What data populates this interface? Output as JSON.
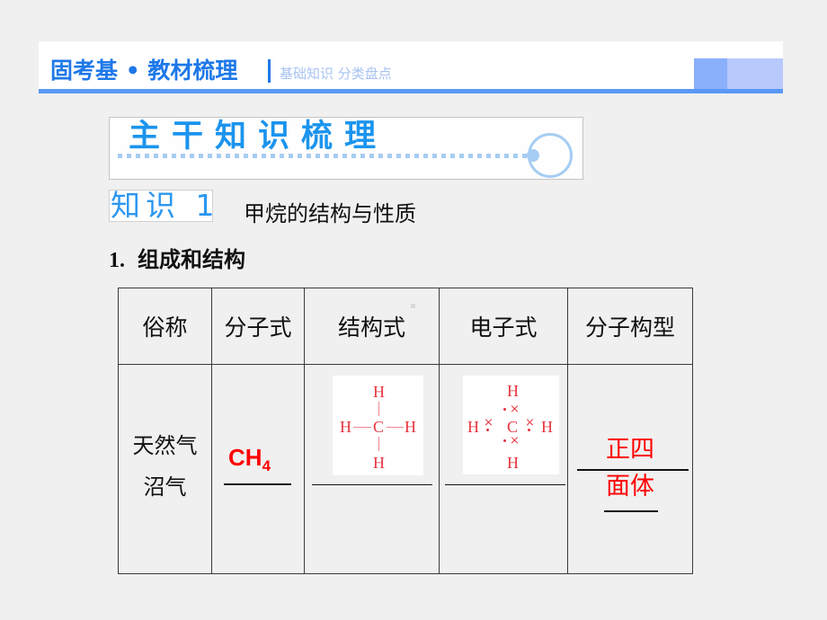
{
  "header": {
    "title": "固考基 • 教材梳理",
    "subtitle": "基础知识  分类盘点"
  },
  "banner": {
    "title": "主干知识梳理"
  },
  "knowledge": {
    "label": "知识 1",
    "heading": "甲烷的结构与性质"
  },
  "section": {
    "number": "1.",
    "heading": "组成和结构"
  },
  "table": {
    "headers": [
      "俗称",
      "分子式",
      "结构式",
      "电子式",
      "分子构型"
    ],
    "row": {
      "common_names": [
        "天然气",
        "沼气"
      ],
      "formula_main": "CH",
      "formula_sub": "4",
      "structural_formula": {
        "center": "C",
        "top": "H",
        "bottom": "H",
        "left": "H",
        "right": "H"
      },
      "electron_formula": {
        "center": "C",
        "top": "H",
        "bottom": "H",
        "left": "H",
        "right": "H",
        "cross": "×"
      },
      "shape_line1": "正四",
      "shape_line2": "面体"
    }
  },
  "colors": {
    "accent_blue": "#1e78e8",
    "answer_red": "#ff0000",
    "diagram_red": "#e6353f"
  }
}
